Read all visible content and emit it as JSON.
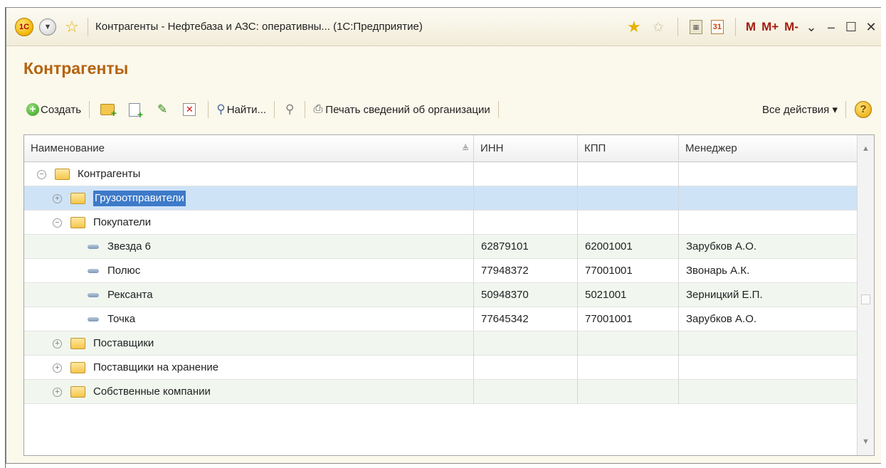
{
  "window": {
    "title": "Контрагенты - Нефтебаза и АЗС: оперативны...  (1С:Предприятие)",
    "logo": "1С",
    "toolbar_glyphs": {
      "m": "M",
      "m_plus": "M+",
      "m_minus": "M-"
    },
    "calendar_number": "31"
  },
  "page": {
    "title": "Контрагенты"
  },
  "toolbar": {
    "create_label": "Создать",
    "find_label": "Найти...",
    "print_label": "Печать сведений об организации",
    "all_actions_label": "Все действия ▾",
    "help_label": "?"
  },
  "table": {
    "columns": [
      "Наименование",
      "ИНН",
      "КПП",
      "Менеджер"
    ],
    "rows": [
      {
        "name": "Контрагенты",
        "inn": "",
        "kpp": "",
        "manager": ""
      },
      {
        "name": "Грузоотправители",
        "inn": "",
        "kpp": "",
        "manager": ""
      },
      {
        "name": "Покупатели",
        "inn": "",
        "kpp": "",
        "manager": ""
      },
      {
        "name": "Звезда 6",
        "inn": "62879101",
        "kpp": "62001001",
        "manager": "Зарубков А.О."
      },
      {
        "name": "Полюс",
        "inn": "77948372",
        "kpp": "77001001",
        "manager": "Звонарь А.К."
      },
      {
        "name": "Рексанта",
        "inn": "50948370",
        "kpp": "5021001",
        "manager": "Зерницкий Е.П."
      },
      {
        "name": "Точка",
        "inn": "77645342",
        "kpp": "77001001",
        "manager": "Зарубков А.О."
      },
      {
        "name": "Поставщики",
        "inn": "",
        "kpp": "",
        "manager": ""
      },
      {
        "name": "Поставщики на хранение",
        "inn": "",
        "kpp": "",
        "manager": ""
      },
      {
        "name": "Собственные компании",
        "inn": "",
        "kpp": "",
        "manager": ""
      }
    ]
  },
  "colors": {
    "title": "#b4630e",
    "selection": "#3d7ac9",
    "row_alt": "#f1f7ef"
  }
}
